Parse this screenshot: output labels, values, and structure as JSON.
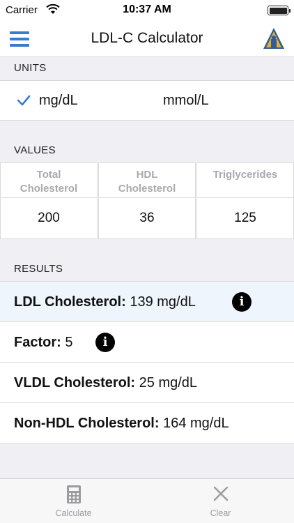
{
  "status": {
    "carrier": "Carrier",
    "time": "10:37 AM"
  },
  "nav": {
    "title": "LDL-C Calculator",
    "menu_icon": "hamburger-menu-icon",
    "logo_icon": "institution-logo-icon"
  },
  "units": {
    "header": "UNITS",
    "options": [
      "mg/dL",
      "mmol/L"
    ],
    "selected": "mg/dL"
  },
  "values": {
    "header": "VALUES",
    "fields": [
      {
        "label_line1": "Total",
        "label_line2": "Cholesterol",
        "value": "200"
      },
      {
        "label_line1": "HDL",
        "label_line2": "Cholesterol",
        "value": "36"
      },
      {
        "label_line1": "Triglycerides",
        "label_line2": "",
        "value": "125"
      }
    ]
  },
  "results": {
    "header": "RESULTS",
    "items": [
      {
        "label": "LDL Cholesterol:",
        "value": "139 mg/dL",
        "has_info": true
      },
      {
        "label": "Factor:",
        "value": "5",
        "has_info": true
      },
      {
        "label": "VLDL Cholesterol:",
        "value": "25 mg/dL",
        "has_info": false
      },
      {
        "label": "Non-HDL Cholesterol:",
        "value": "164 mg/dL",
        "has_info": false
      }
    ]
  },
  "tabs": [
    {
      "label": "Calculate",
      "icon": "calculator-icon"
    },
    {
      "label": "Clear",
      "icon": "close-icon"
    }
  ],
  "colors": {
    "accent": "#3a7bd0",
    "highlight_row": "#eff5fc",
    "tab_inactive": "#9b9ba0"
  }
}
